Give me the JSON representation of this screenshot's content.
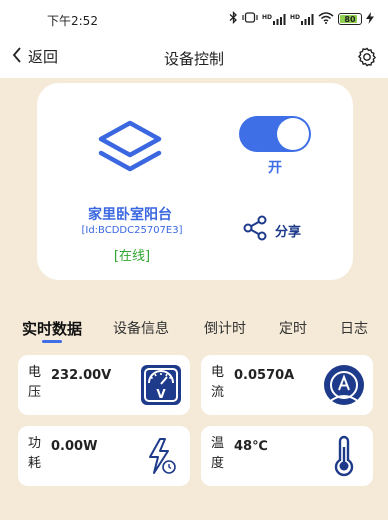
{
  "status_bar": {
    "time": "下午2:52",
    "signal1": "HD",
    "signal2": "HD",
    "battery": "80"
  },
  "nav": {
    "back_label": "返回",
    "title": "设备控制"
  },
  "device": {
    "name": "家里卧室阳台",
    "id": "[Id:BCDDC25707E3]",
    "status": "[在线]",
    "toggle_state": "开",
    "share_label": "分享"
  },
  "tabs": [
    {
      "label": "实时数据",
      "active": true
    },
    {
      "label": "设备信息",
      "active": false
    },
    {
      "label": "倒计时",
      "active": false
    },
    {
      "label": "定时",
      "active": false
    },
    {
      "label": "日志",
      "active": false
    }
  ],
  "metrics": [
    {
      "label": "电压",
      "value": "232.00V",
      "icon": "voltmeter-icon"
    },
    {
      "label": "电流",
      "value": "0.0570A",
      "icon": "ammeter-icon"
    },
    {
      "label": "功耗",
      "value": "0.00W",
      "icon": "power-timer-icon"
    },
    {
      "label": "温度",
      "value": "48℃",
      "icon": "thermometer-icon"
    }
  ],
  "colors": {
    "accent": "#3e6fe6",
    "background": "#f5ead7",
    "online": "#2fa52f",
    "dark_icon": "#1e3a8a"
  }
}
